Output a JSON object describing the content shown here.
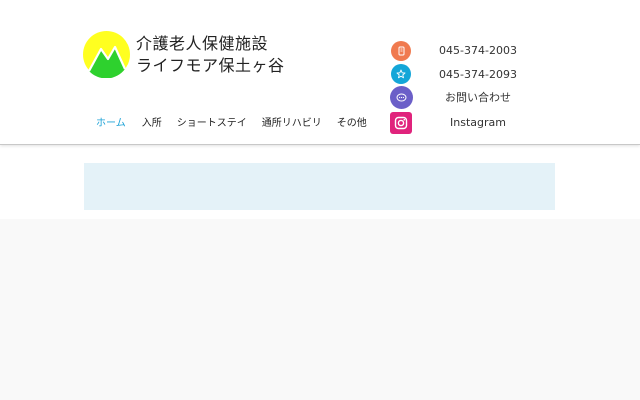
{
  "site": {
    "title_line1": "介護老人保健施設",
    "title_line2": "ライフモア保土ヶ谷"
  },
  "nav": {
    "items": [
      {
        "label": "ホーム"
      },
      {
        "label": "入所"
      },
      {
        "label": "ショートステイ"
      },
      {
        "label": "通所リハビリ"
      },
      {
        "label": "その他"
      }
    ]
  },
  "contact": {
    "phone1": "045-374-2003",
    "phone2": "045-374-2093",
    "inquiry": "お問い合わせ",
    "instagram": "Instagram"
  },
  "icons": {
    "phone": "phone-icon",
    "fax": "fax-icon",
    "mail": "chat-icon",
    "instagram": "instagram-icon"
  },
  "colors": {
    "nav_active": "#1fa3d7",
    "phone_icon": "#f07a4f",
    "fax_icon": "#14a6d8",
    "mail_icon": "#6b5fc8",
    "instagram_icon": "#e0237c",
    "banner": "#e4f2f8",
    "logo_yellow": "#ffff20",
    "logo_green": "#2ed12e"
  }
}
